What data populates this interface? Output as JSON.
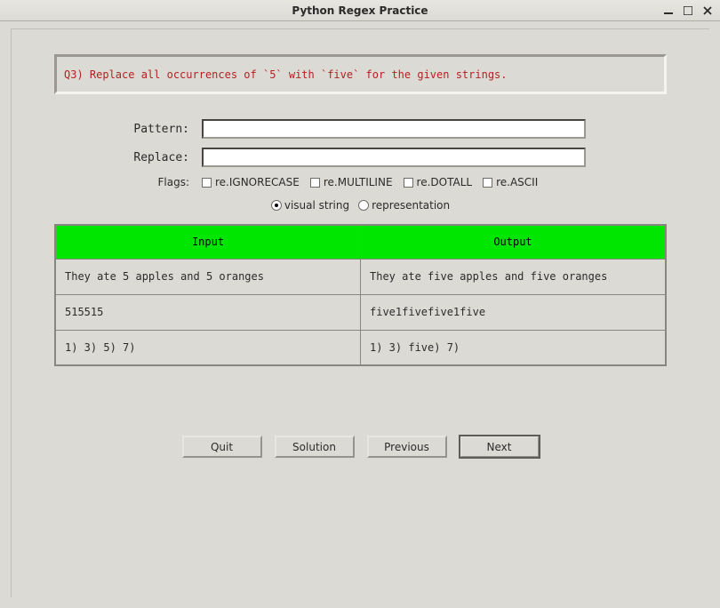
{
  "window": {
    "title": "Python Regex Practice"
  },
  "question": "Q3) Replace all occurrences of `5` with `five` for the given strings.",
  "fields": {
    "pattern_label": "Pattern:",
    "replace_label": "Replace:",
    "flags_label": "Flags:",
    "pattern_value": "",
    "replace_value": ""
  },
  "flags": {
    "opt1": "re.IGNORECASE",
    "opt2": "re.MULTILINE",
    "opt3": "re.DOTALL",
    "opt4": "re.ASCII"
  },
  "viewmode": {
    "visual": "visual string",
    "repr": "representation"
  },
  "table": {
    "head_input": "Input",
    "head_output": "Output",
    "rows": [
      {
        "input": "They ate 5 apples and 5 oranges",
        "output": "They ate five apples and five oranges"
      },
      {
        "input": "515515",
        "output": "five1fivefive1five"
      },
      {
        "input": "1) 3) 5) 7)",
        "output": "1) 3) five) 7)"
      }
    ]
  },
  "buttons": {
    "quit": "Quit",
    "solution": "Solution",
    "previous": "Previous",
    "next": "Next"
  }
}
